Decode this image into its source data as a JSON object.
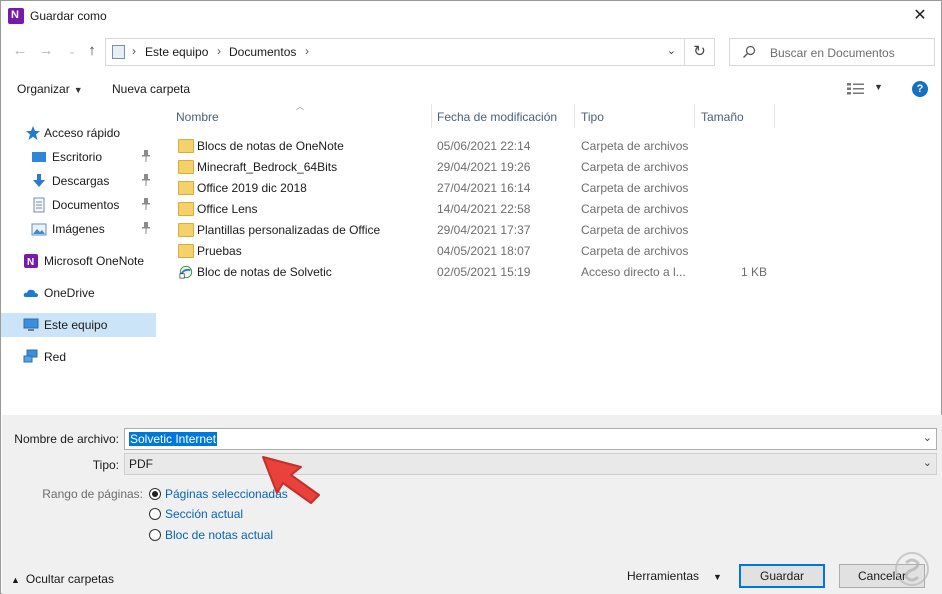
{
  "window": {
    "title": "Guardar como"
  },
  "address": {
    "crumbs": [
      "Este equipo",
      "Documentos"
    ]
  },
  "search": {
    "placeholder": "Buscar en Documentos"
  },
  "toolbar": {
    "organize": "Organizar",
    "new_folder": "Nueva carpeta"
  },
  "sidebar": {
    "items": [
      {
        "label": "Acceso rápido",
        "icon": "star-icon"
      },
      {
        "label": "Escritorio",
        "icon": "desktop-icon",
        "pinned": true
      },
      {
        "label": "Descargas",
        "icon": "download-icon",
        "pinned": true
      },
      {
        "label": "Documentos",
        "icon": "document-icon",
        "pinned": true
      },
      {
        "label": "Imágenes",
        "icon": "image-icon",
        "pinned": true
      },
      {
        "label": "Microsoft OneNote",
        "icon": "onenote-icon"
      },
      {
        "label": "OneDrive",
        "icon": "cloud-icon"
      },
      {
        "label": "Este equipo",
        "icon": "computer-icon",
        "selected": true
      },
      {
        "label": "Red",
        "icon": "network-icon"
      }
    ]
  },
  "columns": [
    "Nombre",
    "Fecha de modificación",
    "Tipo",
    "Tamaño"
  ],
  "files": [
    {
      "name": "Blocs de notas de OneNote",
      "date": "05/06/2021 22:14",
      "type": "Carpeta de archivos",
      "size": ""
    },
    {
      "name": "Minecraft_Bedrock_64Bits",
      "date": "29/04/2021 19:26",
      "type": "Carpeta de archivos",
      "size": ""
    },
    {
      "name": "Office 2019 dic 2018",
      "date": "27/04/2021 16:14",
      "type": "Carpeta de archivos",
      "size": ""
    },
    {
      "name": "Office Lens",
      "date": "14/04/2021 22:58",
      "type": "Carpeta de archivos",
      "size": ""
    },
    {
      "name": "Plantillas personalizadas de Office",
      "date": "29/04/2021 17:37",
      "type": "Carpeta de archivos",
      "size": ""
    },
    {
      "name": "Pruebas",
      "date": "04/05/2021 18:07",
      "type": "Carpeta de archivos",
      "size": ""
    },
    {
      "name": "Bloc de notas de Solvetic",
      "date": "02/05/2021 15:19",
      "type": "Acceso directo a l...",
      "size": "1 KB"
    }
  ],
  "form": {
    "filename_label": "Nombre de archivo:",
    "filename_value": "Solvetic Internet",
    "type_label": "Tipo:",
    "type_value": "PDF",
    "range_label": "Rango de páginas:",
    "range_options": [
      "Páginas seleccionadas",
      "Sección actual",
      "Bloc de notas actual"
    ],
    "range_selected": 0
  },
  "footer": {
    "hide_folders": "Ocultar carpetas",
    "tools": "Herramientas",
    "save": "Guardar",
    "cancel": "Cancelar"
  },
  "colors": {
    "accent": "#0078d7",
    "arrow": "#e8423b",
    "folder": "#f5d16b",
    "selection": "#cce4f7"
  }
}
